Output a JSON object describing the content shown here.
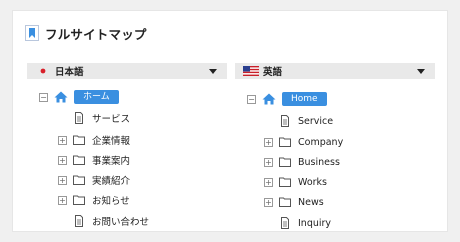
{
  "title": "フルサイトマップ",
  "colors": {
    "accent": "#3a8fe0",
    "bar": "#e9e9e9"
  },
  "panels": {
    "japanese": {
      "language": "日本語",
      "flag": "japan-flag-icon",
      "home": "ホーム",
      "items": [
        {
          "label": "サービス",
          "type": "file",
          "expandable": false
        },
        {
          "label": "企業情報",
          "type": "folder",
          "expandable": true
        },
        {
          "label": "事業案内",
          "type": "folder",
          "expandable": true
        },
        {
          "label": "実績紹介",
          "type": "folder",
          "expandable": true
        },
        {
          "label": "お知らせ",
          "type": "folder",
          "expandable": true
        },
        {
          "label": "お問い合わせ",
          "type": "file",
          "expandable": false
        }
      ]
    },
    "english": {
      "language": "英語",
      "flag": "us-flag-icon",
      "home": "Home",
      "items": [
        {
          "label": "Service",
          "type": "file",
          "expandable": false
        },
        {
          "label": "Company",
          "type": "folder",
          "expandable": true
        },
        {
          "label": "Business",
          "type": "folder",
          "expandable": true
        },
        {
          "label": "Works",
          "type": "folder",
          "expandable": true
        },
        {
          "label": "News",
          "type": "folder",
          "expandable": true
        },
        {
          "label": "Inquiry",
          "type": "file",
          "expandable": false
        }
      ]
    }
  }
}
